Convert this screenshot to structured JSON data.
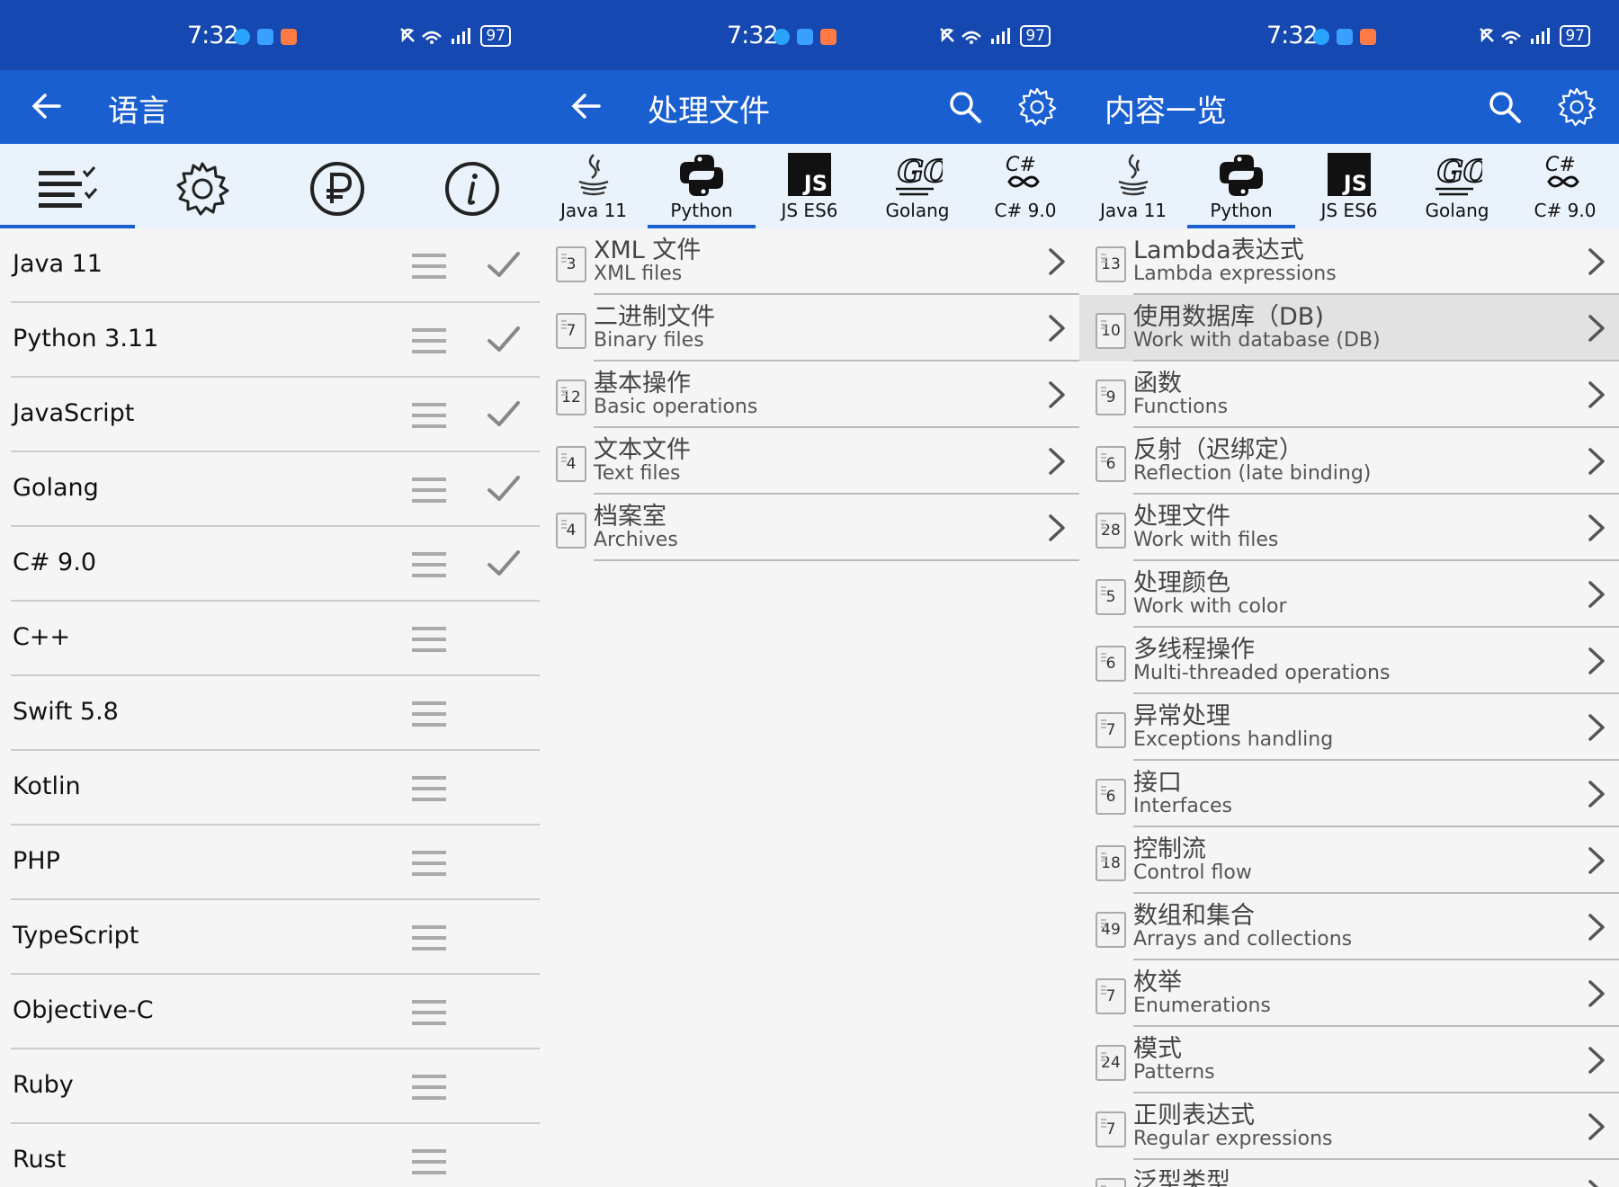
{
  "status": {
    "time": "7:32",
    "battery": "97"
  },
  "panel1": {
    "title": "语言",
    "languages": [
      {
        "name": "Java 11",
        "checked": true
      },
      {
        "name": "Python 3.11",
        "checked": true
      },
      {
        "name": "JavaScript",
        "checked": true
      },
      {
        "name": "Golang",
        "checked": true
      },
      {
        "name": "C# 9.0",
        "checked": true
      },
      {
        "name": "C++",
        "checked": false
      },
      {
        "name": "Swift 5.8",
        "checked": false
      },
      {
        "name": "Kotlin",
        "checked": false
      },
      {
        "name": "PHP",
        "checked": false
      },
      {
        "name": "TypeScript",
        "checked": false
      },
      {
        "name": "Objective-C",
        "checked": false
      },
      {
        "name": "Ruby",
        "checked": false
      },
      {
        "name": "Rust",
        "checked": false
      }
    ]
  },
  "lang_tabs": [
    {
      "label": "Java 11",
      "icon": "java-icon"
    },
    {
      "label": "Python",
      "icon": "python-icon"
    },
    {
      "label": "JS ES6",
      "icon": "js-icon"
    },
    {
      "label": "Golang",
      "icon": "go-icon"
    },
    {
      "label": "C# 9.0",
      "icon": "csharp-icon"
    }
  ],
  "panel2": {
    "title": "处理文件",
    "topics": [
      {
        "count": "3",
        "zh": "XML 文件",
        "en": "XML files"
      },
      {
        "count": "7",
        "zh": "二进制文件",
        "en": "Binary files"
      },
      {
        "count": "12",
        "zh": "基本操作",
        "en": "Basic operations"
      },
      {
        "count": "4",
        "zh": "文本文件",
        "en": "Text files"
      },
      {
        "count": "4",
        "zh": "档案室",
        "en": "Archives"
      }
    ]
  },
  "panel3": {
    "title": "内容一览",
    "topics": [
      {
        "count": "13",
        "zh": "Lambda表达式",
        "en": "Lambda expressions"
      },
      {
        "count": "10",
        "zh": "使用数据库（DB)",
        "en": "Work with database (DB)"
      },
      {
        "count": "9",
        "zh": "函数",
        "en": "Functions"
      },
      {
        "count": "6",
        "zh": "反射（迟绑定）",
        "en": "Reflection (late binding)"
      },
      {
        "count": "28",
        "zh": "处理文件",
        "en": "Work with files"
      },
      {
        "count": "5",
        "zh": "处理颜色",
        "en": "Work with color"
      },
      {
        "count": "6",
        "zh": "多线程操作",
        "en": "Multi-threaded operations"
      },
      {
        "count": "7",
        "zh": "异常处理",
        "en": "Exceptions handling"
      },
      {
        "count": "6",
        "zh": "接口",
        "en": "Interfaces"
      },
      {
        "count": "18",
        "zh": "控制流",
        "en": "Control flow"
      },
      {
        "count": "49",
        "zh": "数组和集合",
        "en": "Arrays and collections"
      },
      {
        "count": "7",
        "zh": "枚举",
        "en": "Enumerations"
      },
      {
        "count": "24",
        "zh": "模式",
        "en": "Patterns"
      },
      {
        "count": "7",
        "zh": "正则表达式",
        "en": "Regular expressions"
      },
      {
        "count": "",
        "zh": "泛型类型",
        "en": ""
      }
    ]
  },
  "colors": {
    "statusbar": "#1548b0",
    "appbar": "#1a5fd0",
    "tabbar": "#eaf2fb"
  }
}
